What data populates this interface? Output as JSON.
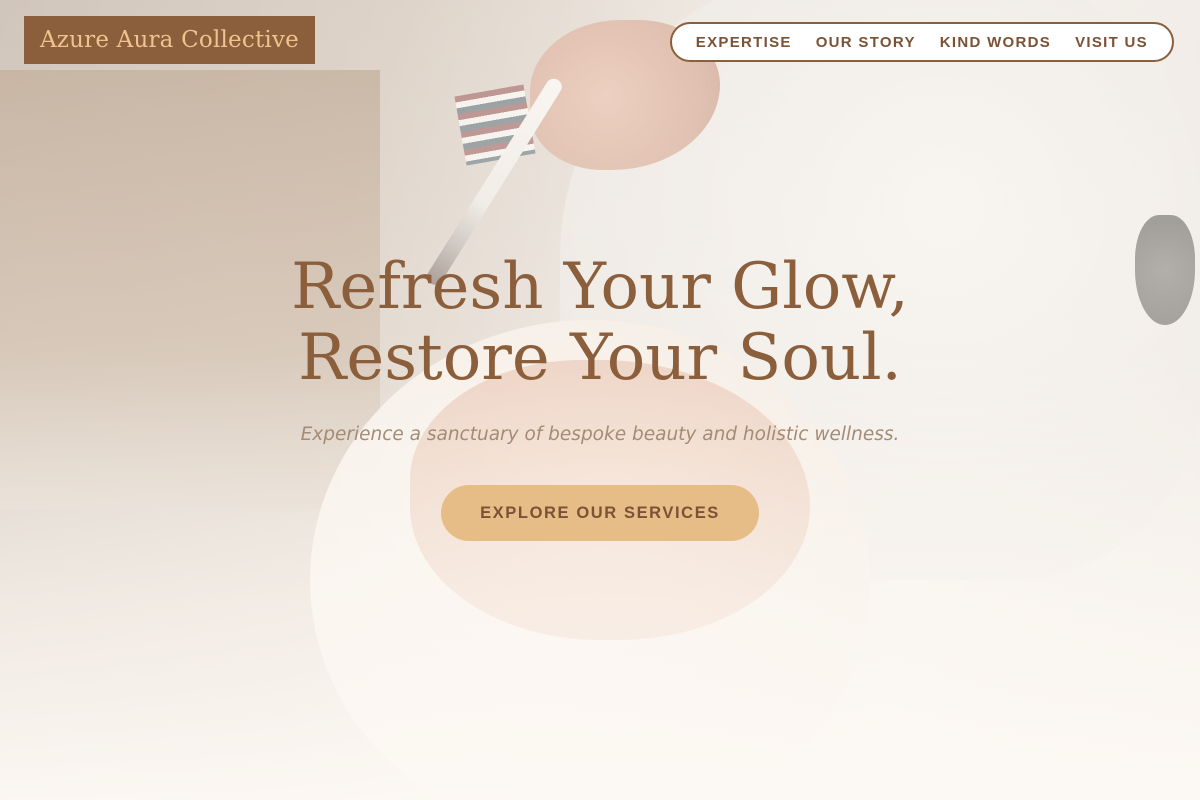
{
  "brand": {
    "logo_text": "Azure Aura Collective"
  },
  "nav": {
    "items": [
      {
        "label": "EXPERTISE"
      },
      {
        "label": "OUR STORY"
      },
      {
        "label": "KIND WORDS"
      },
      {
        "label": "VISIT US"
      }
    ]
  },
  "hero": {
    "headline_line1": "Refresh Your Glow,",
    "headline_line2": "Restore Your Soul.",
    "subtitle": "Experience a sanctuary of bespoke beauty and holistic wellness.",
    "cta_label": "EXPLORE OUR SERVICES",
    "background_image": "spa-facial-treatment-photo"
  },
  "colors": {
    "brand_brown": "#8b5e3c",
    "logo_text": "#f0c28e",
    "cta_background": "#e6bd87",
    "nav_text": "#7a5236",
    "page_background": "#fdf9f4"
  }
}
